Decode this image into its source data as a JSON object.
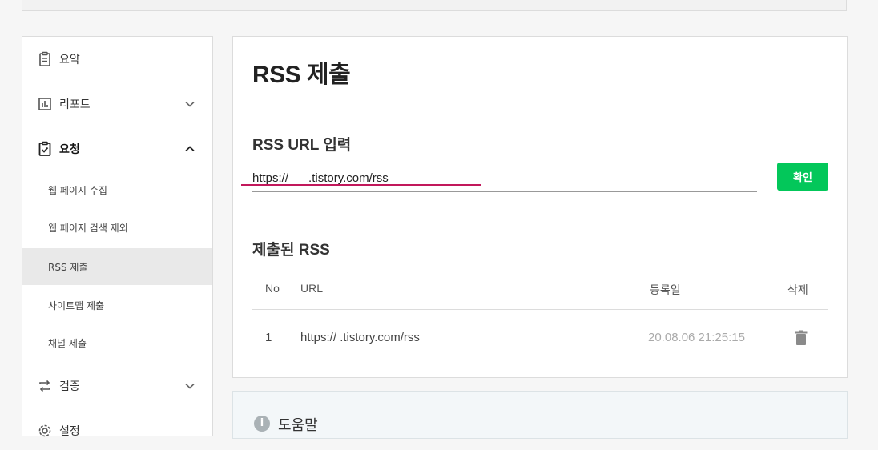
{
  "sidebar": {
    "items": [
      {
        "label": "요약",
        "icon": "clipboard-icon"
      },
      {
        "label": "리포트",
        "icon": "bar-chart-icon",
        "chevron": "down"
      },
      {
        "label": "요청",
        "icon": "clipboard-check-icon",
        "chevron": "up"
      },
      {
        "label": "검증",
        "icon": "repeat-icon",
        "chevron": "down"
      },
      {
        "label": "설정",
        "icon": "gear-icon"
      }
    ],
    "sub_items": [
      {
        "label": "웹 페이지 수집"
      },
      {
        "label": "웹 페이지 검색 제외"
      },
      {
        "label": "RSS 제출",
        "active": true
      },
      {
        "label": "사이트맵 제출"
      },
      {
        "label": "채널 제출"
      }
    ]
  },
  "main": {
    "title": "RSS 제출",
    "input_section_title": "RSS URL 입력",
    "url_input_value": "https://      .tistory.com/rss",
    "confirm_label": "확인",
    "submitted_section_title": "제출된 RSS",
    "table": {
      "headers": {
        "no": "No",
        "url": "URL",
        "date": "등록일",
        "delete": "삭제"
      },
      "rows": [
        {
          "no": "1",
          "url": "https://     .tistory.com/rss",
          "date": "20.08.06 21:25:15"
        }
      ]
    }
  },
  "help": {
    "title": "도움말",
    "icon_glyph": "i"
  },
  "colors": {
    "accent_green": "#03c75a",
    "annotation_red": "#c2185b"
  }
}
